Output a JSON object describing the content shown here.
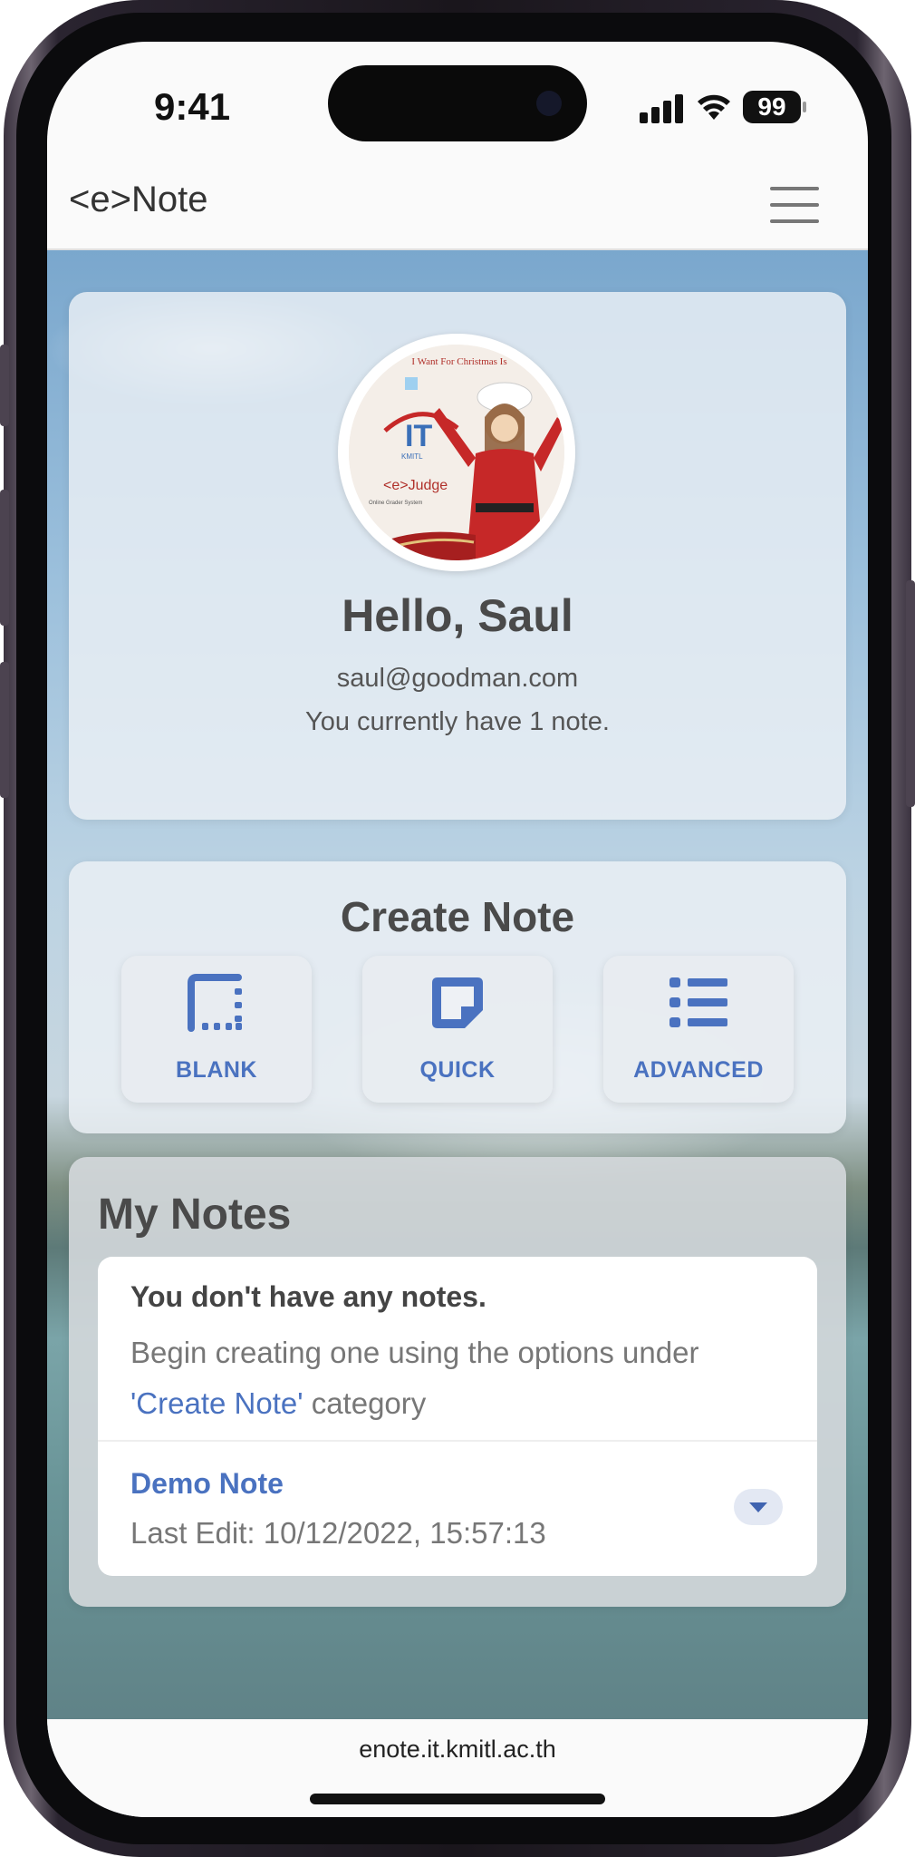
{
  "status_bar": {
    "time": "9:41",
    "battery": "99"
  },
  "navbar": {
    "brand": "<e>Note"
  },
  "profile": {
    "greeting": "Hello, Saul",
    "email": "saul@goodman.com",
    "note_count_text": "You currently have 1 note.",
    "avatar_text": {
      "banner": "I Want For Christmas Is",
      "logo": "IT",
      "logo_sub": "KMITL",
      "product": "<e>Judge",
      "tagline": "Online Grader System"
    }
  },
  "create_note": {
    "title": "Create Note",
    "options": [
      {
        "label": "BLANK",
        "icon": "blank-note-icon"
      },
      {
        "label": "QUICK",
        "icon": "quick-note-icon"
      },
      {
        "label": "ADVANCED",
        "icon": "list-icon"
      }
    ]
  },
  "my_notes": {
    "title": "My Notes",
    "empty_title": "You don't have any notes.",
    "empty_body_prefix": "Begin creating one using the options under ",
    "empty_body_link": "'Create Note'",
    "empty_body_suffix": " category",
    "notes": [
      {
        "name": "Demo Note",
        "last_edit": "Last Edit: 10/12/2022, 15:57:13"
      }
    ]
  },
  "browser": {
    "url": "enote.it.kmitl.ac.th"
  },
  "colors": {
    "accent": "#4a72c0",
    "heading": "#4a4a4a"
  }
}
